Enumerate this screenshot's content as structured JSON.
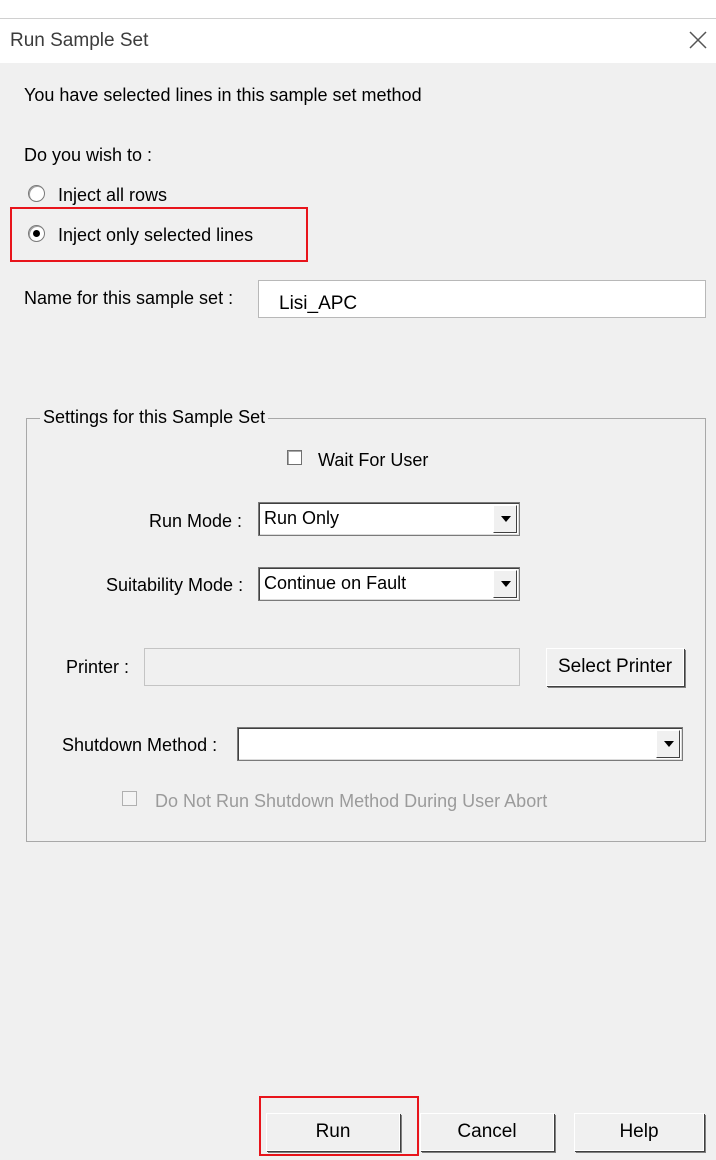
{
  "dialog": {
    "title": "Run Sample Set",
    "message": "You have selected lines in this sample set method",
    "question": "Do you wish to :",
    "options": [
      {
        "label": "Inject all rows",
        "selected": false
      },
      {
        "label": "Inject only selected lines",
        "selected": true
      }
    ],
    "name_label": "Name for this sample set :",
    "name_value": "Lisi_APC"
  },
  "settings": {
    "group_title": "Settings for this Sample Set",
    "wait_for_user_label": "Wait For User",
    "wait_for_user_checked": false,
    "run_mode_label": "Run Mode :",
    "run_mode_value": "Run Only",
    "suitability_mode_label": "Suitability Mode :",
    "suitability_mode_value": "Continue on Fault",
    "printer_label": "Printer :",
    "printer_value": "",
    "select_printer_label": "Select Printer",
    "shutdown_method_label": "Shutdown Method :",
    "shutdown_method_value": "",
    "no_shutdown_abort_label": "Do Not Run Shutdown Method During User Abort",
    "no_shutdown_abort_enabled": false
  },
  "buttons": {
    "run": "Run",
    "cancel": "Cancel",
    "help": "Help"
  },
  "colors": {
    "highlight": "#e8141b",
    "dialog_bg": "#f0f0f0"
  },
  "icons": [
    "close-icon",
    "dropdown-arrow-icon"
  ]
}
